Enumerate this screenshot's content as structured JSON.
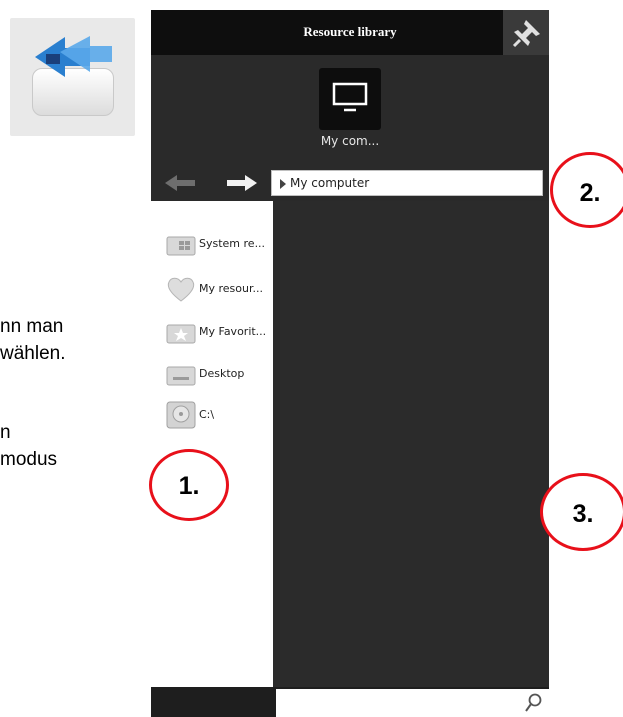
{
  "left_text": {
    "line1": "nn man",
    "line2": "wählen.",
    "line3": "n",
    "line4": "modus"
  },
  "panel": {
    "title": "Resource library",
    "pin_icon": "pin-icon",
    "computer_label": "My com...",
    "path": "My computer"
  },
  "sidebar": {
    "items": [
      {
        "label": "System re...",
        "icon": "system-icon"
      },
      {
        "label": "My resour...",
        "icon": "heart-icon"
      },
      {
        "label": "My Favorit...",
        "icon": "star-folder-icon"
      },
      {
        "label": "Desktop",
        "icon": "desktop-icon"
      },
      {
        "label": "C:\\",
        "icon": "drive-icon"
      }
    ]
  },
  "search": {
    "placeholder": ""
  },
  "callouts": [
    "1.",
    "2.",
    "3."
  ],
  "colors": {
    "callout_border": "#e8101a",
    "panel_bg": "#2a2a2a",
    "titlebar_bg": "#0e0e0e"
  }
}
